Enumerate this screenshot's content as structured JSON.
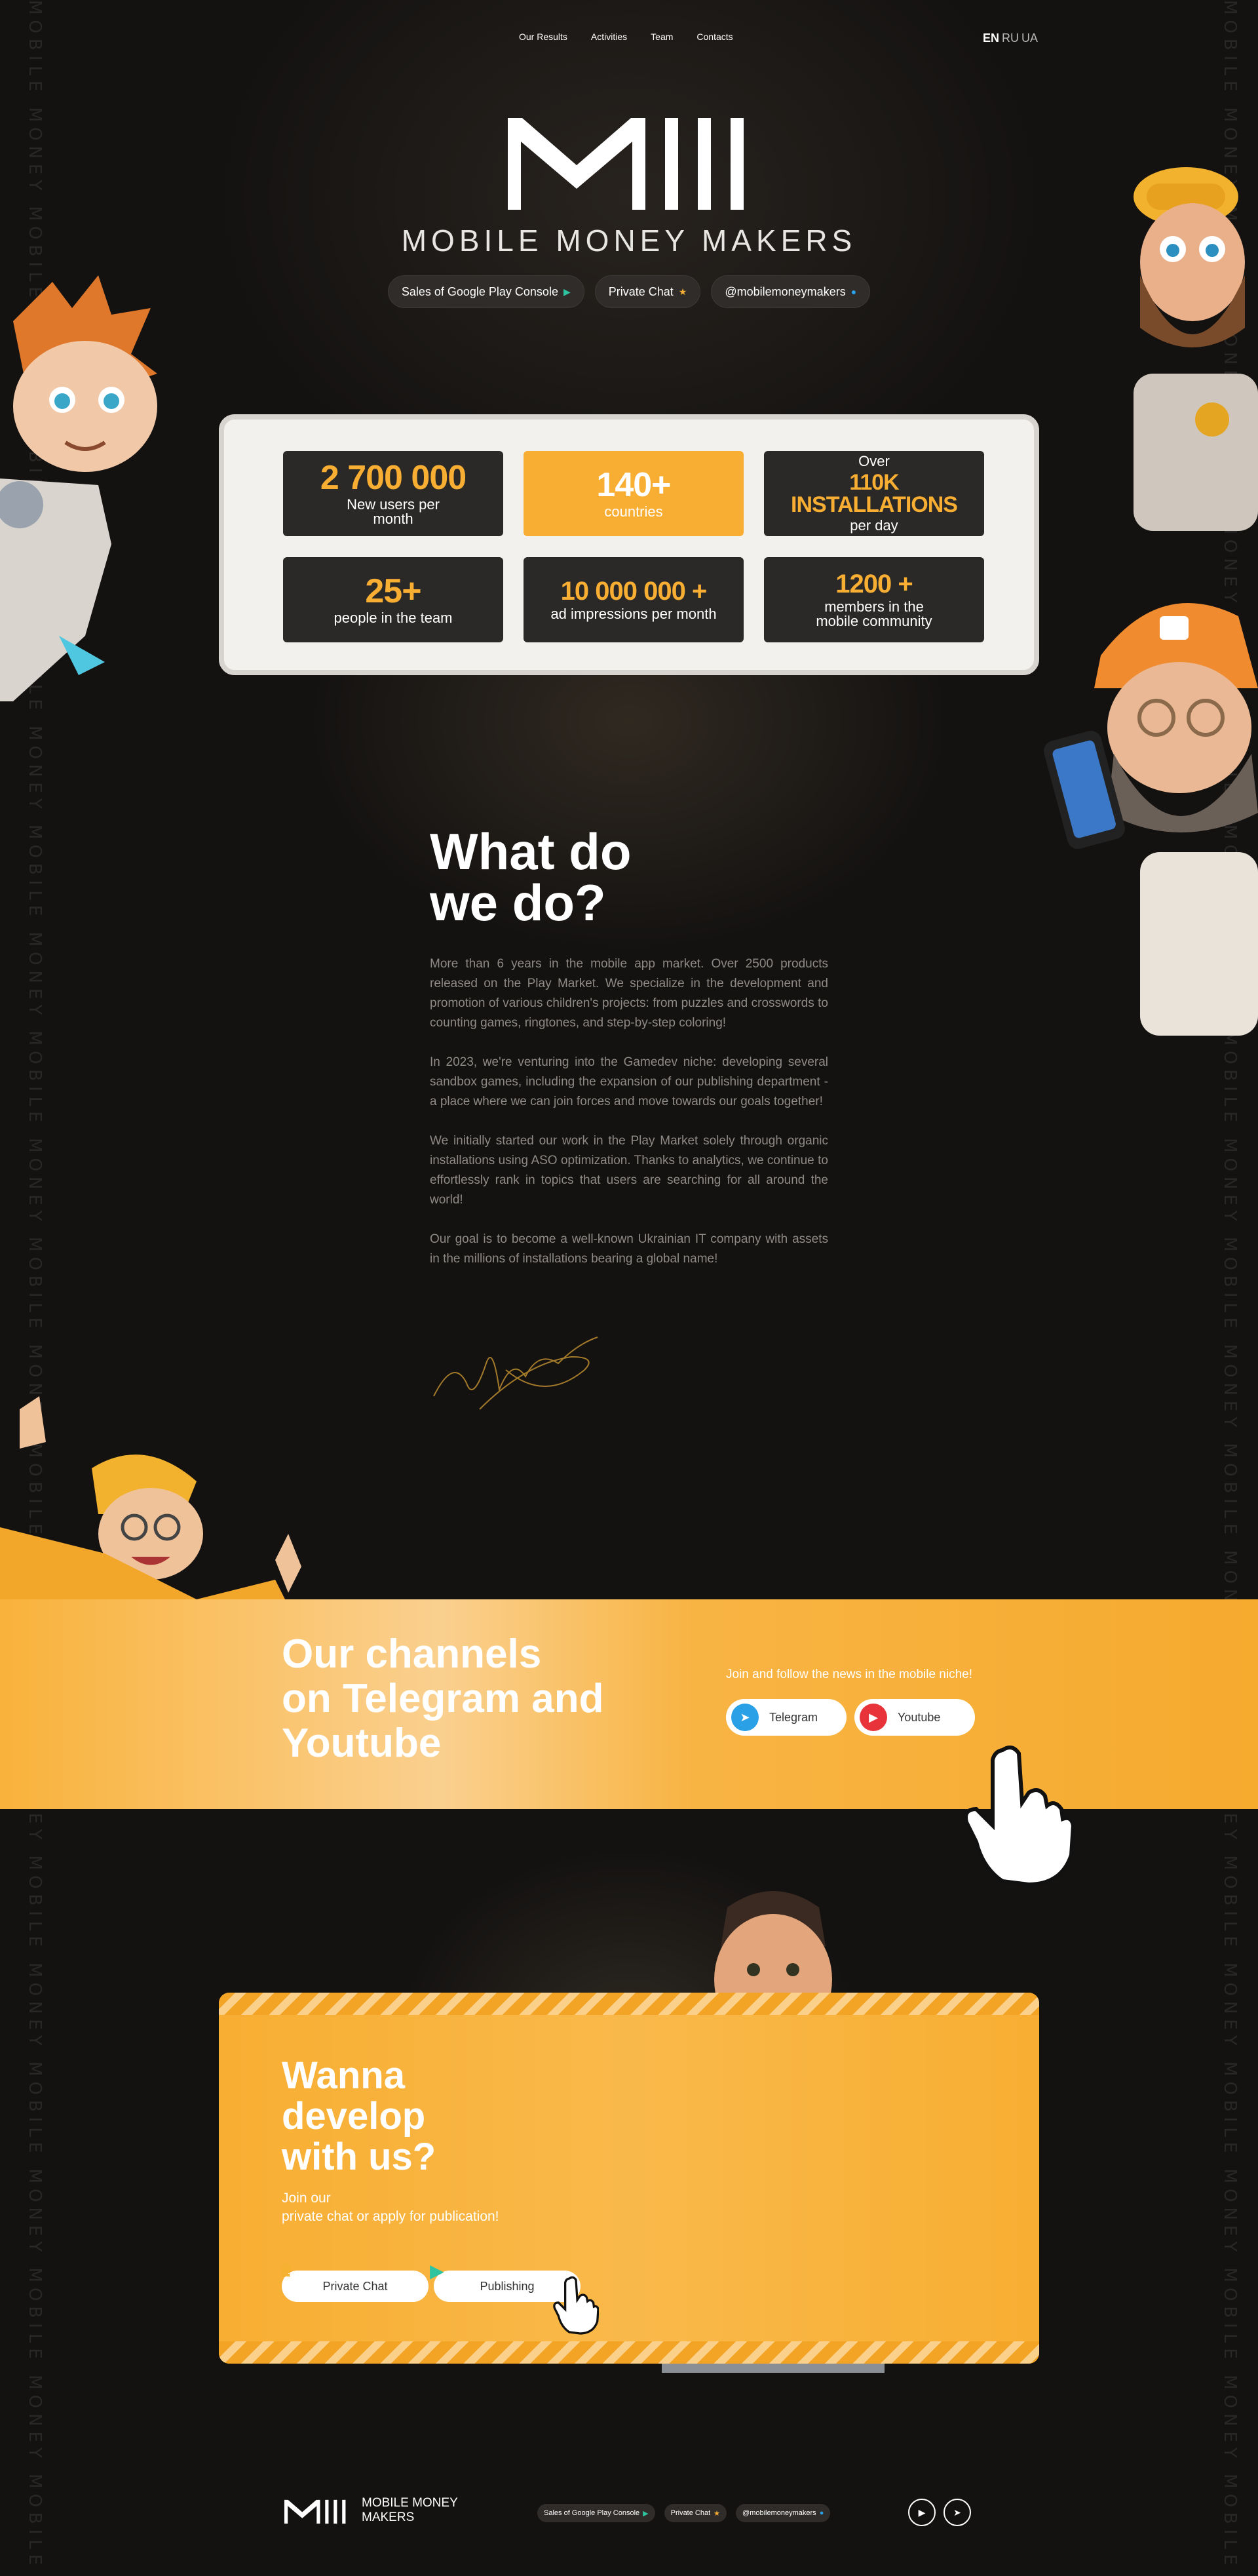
{
  "nav": {
    "links": [
      "Our Results",
      "Activities",
      "Team",
      "Contacts"
    ],
    "langs": [
      "EN",
      "RU",
      "UA"
    ],
    "active_lang": "EN"
  },
  "side_text": "MOBILE MONEY MOBILE MONEY MOBILE MONEY MOBILE MONEY MOBILE MONEY MOBILE MONEY MOBILE MONEY MOBILE MONEY MOBILE MONEY MOBILE MONEY MOBILE MONEY MOBILE MONEY MOBILE MONEY MOBILE MONEY MOBILE MONEY MOBILE MONEY",
  "hero": {
    "brand_name": "MOBILE MONEY MAKERS",
    "pills": [
      {
        "label": "Sales of Google Play Console",
        "icon": "play-icon"
      },
      {
        "label": "Private Chat",
        "icon": "star-icon"
      },
      {
        "label": "@mobilemoneymakers",
        "icon": "dot-icon"
      }
    ]
  },
  "stats": [
    {
      "value": "2 700 000",
      "label": "New users per\nmonth",
      "style": "dark"
    },
    {
      "value": "140+",
      "label": "countries",
      "style": "orange"
    },
    {
      "pre": "Over",
      "value": "110K INSTALLATIONS",
      "label": "per day",
      "style": "dark"
    },
    {
      "value": "25+",
      "label": "people in the team",
      "style": "dark"
    },
    {
      "value": "10 000 000 +",
      "label": "ad impressions per month",
      "style": "dark"
    },
    {
      "value": "1200 +",
      "label": "members in the\nmobile community",
      "style": "dark"
    }
  ],
  "what": {
    "title": "What do\nwe do?",
    "paragraphs": [
      "More than 6 years in the mobile app market. Over 2500 products released on the Play Market. We specialize in the development and promotion of various children's projects: from puzzles and crosswords to counting games, ringtones, and step-by-step coloring!",
      "In 2023, we're venturing into the Gamedev niche: developing several sandbox games, including the expansion of our publishing department - a place where we can join forces and move towards our goals together!",
      "We initially started our work in the Play Market solely through organic installations using ASO optimization. Thanks to analytics, we continue to effortlessly rank in topics that users are searching for all around the world!",
      "Our goal is to become a well-known Ukrainian IT company with assets in the millions of installations bearing a global name!"
    ]
  },
  "channels": {
    "title": "Our channels\non Telegram and\nYoutube",
    "join_text": "Join and follow the news in the mobile niche!",
    "telegram_label": "Telegram",
    "youtube_label": "Youtube"
  },
  "develop": {
    "title": "Wanna\ndevelop\nwith us?",
    "subtitle": "Join our\nprivate chat or apply for publication!",
    "private_chat_label": "Private Chat",
    "publishing_label": "Publishing"
  },
  "footer": {
    "name": "MOBILE MONEY\nMAKERS",
    "pills": [
      {
        "label": "Sales of Google Play Console"
      },
      {
        "label": "Private Chat"
      },
      {
        "label": "@mobilemoneymakers"
      }
    ]
  },
  "colors": {
    "accent": "#f8ae32",
    "background": "#141211",
    "card_dark": "#2b2928"
  }
}
